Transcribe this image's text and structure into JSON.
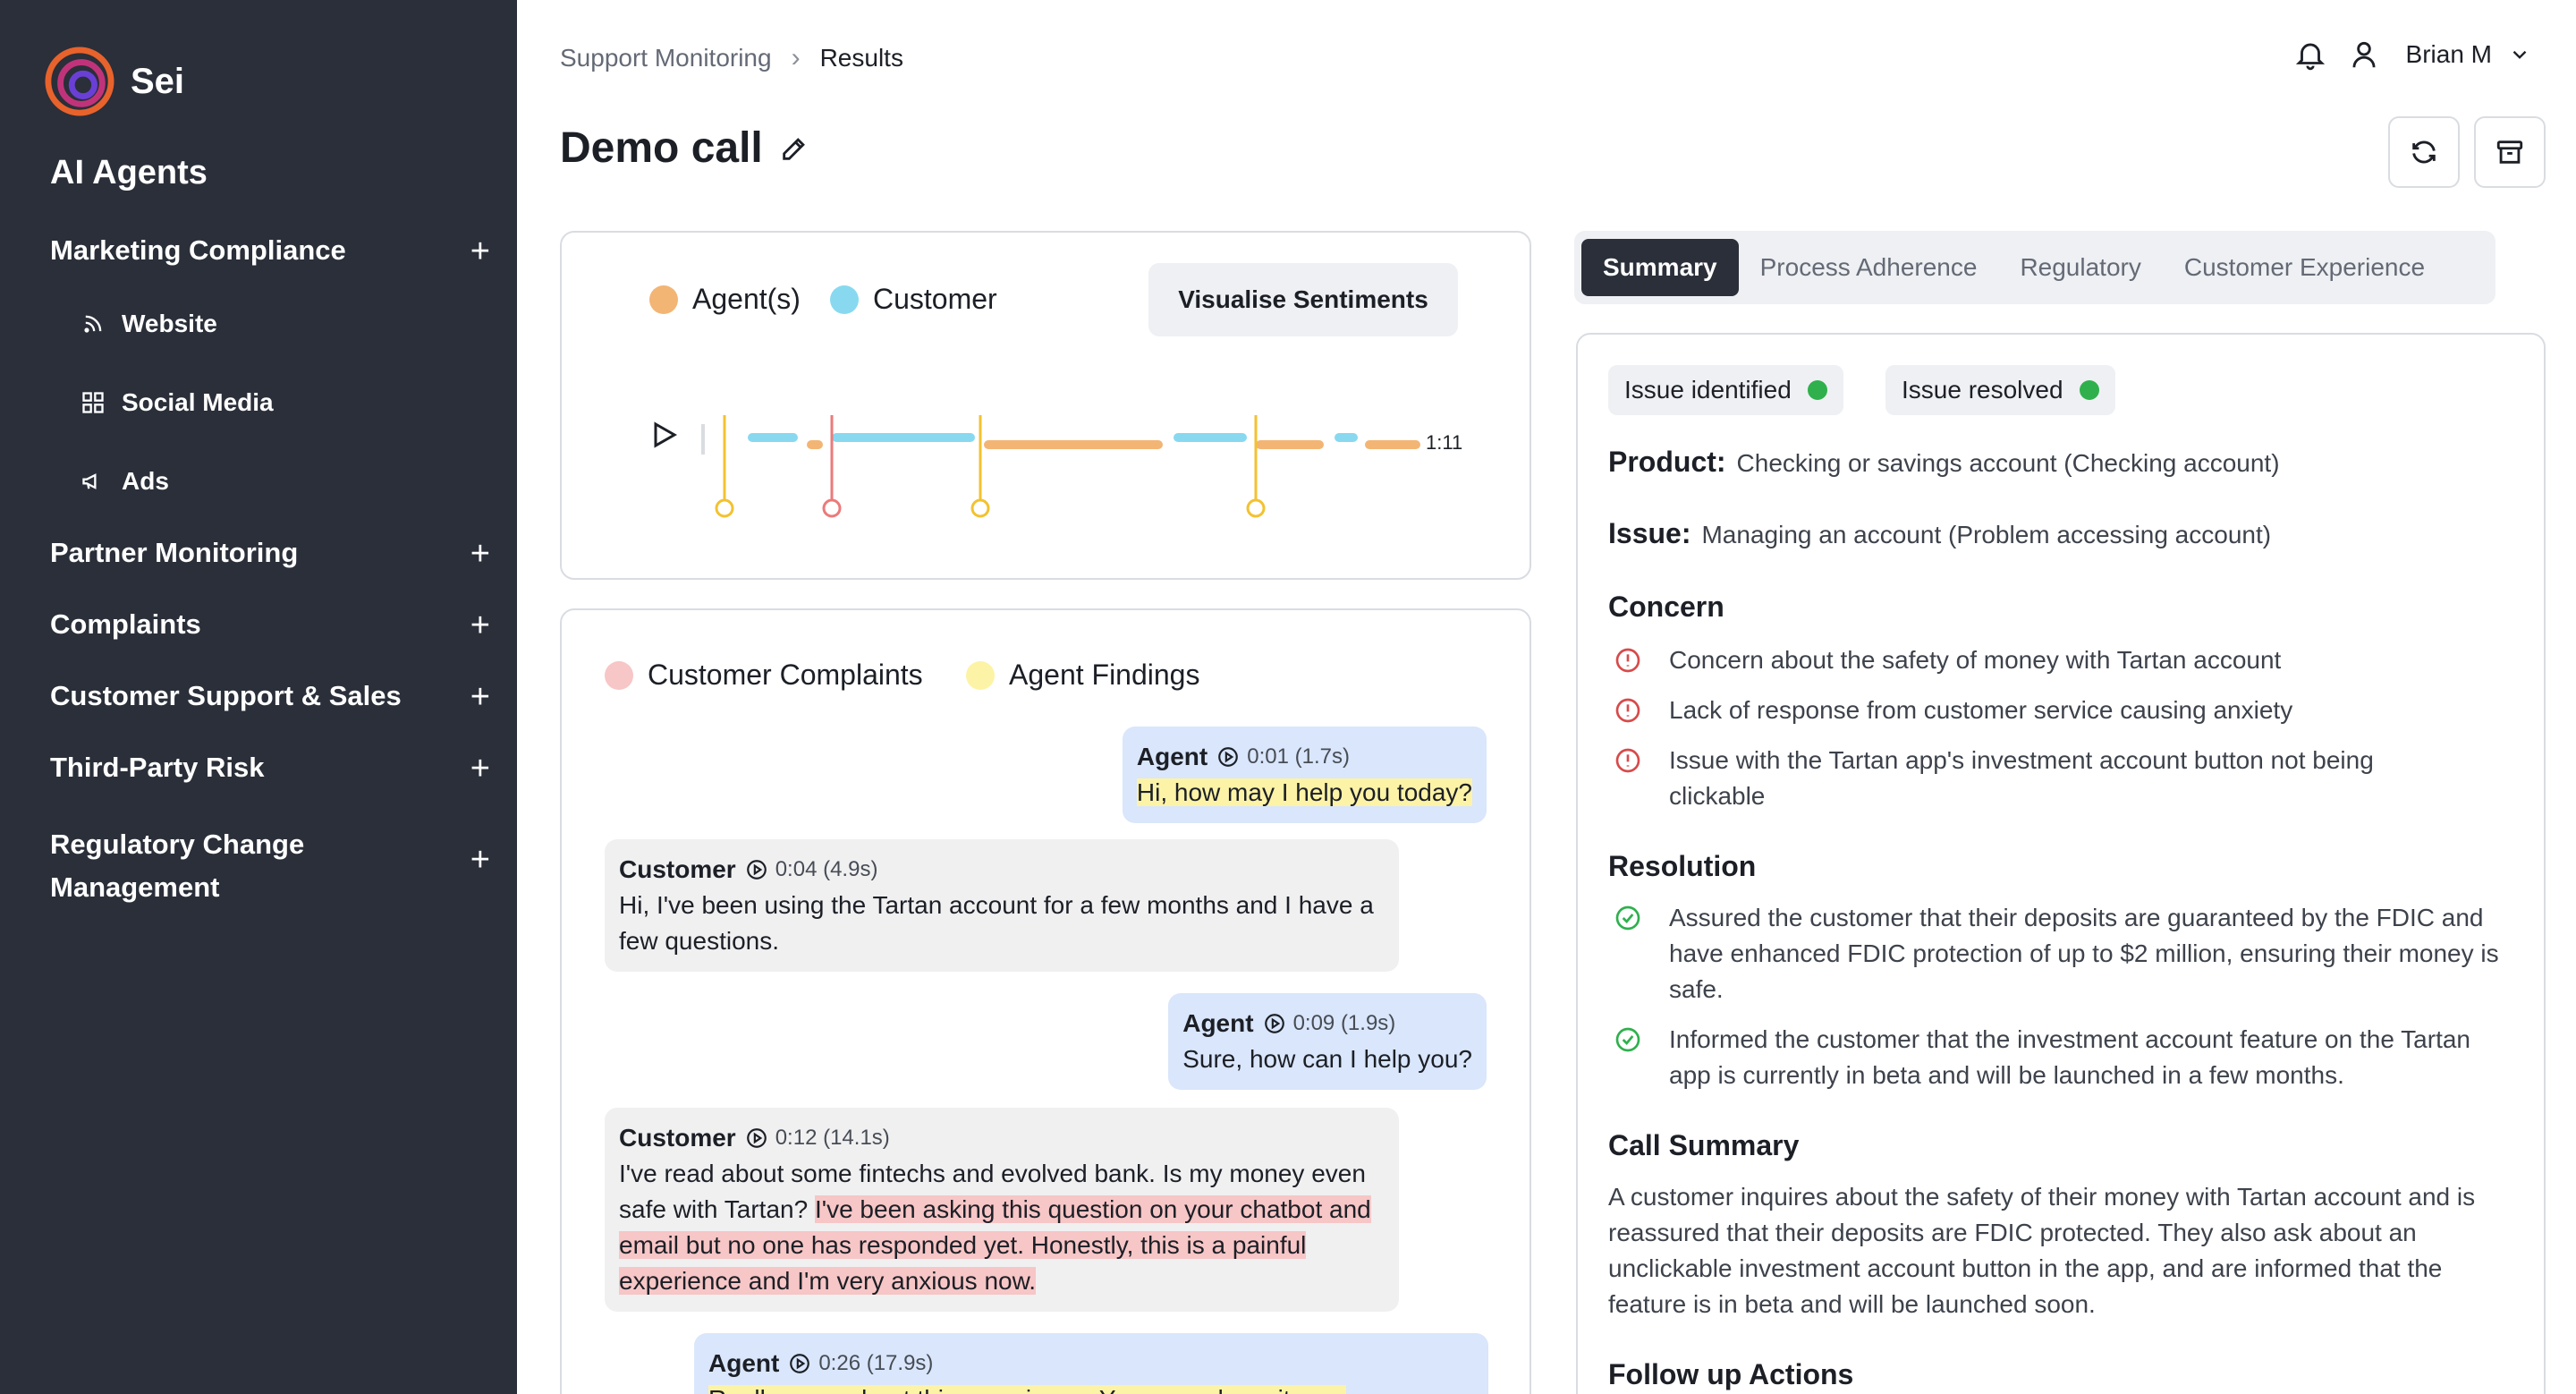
{
  "app": {
    "name": "Sei",
    "section": "AI Agents"
  },
  "sidebar": {
    "items": [
      {
        "label": "Marketing Compliance",
        "children": [
          "Website",
          "Social Media",
          "Ads"
        ]
      },
      {
        "label": "Partner Monitoring"
      },
      {
        "label": "Complaints"
      },
      {
        "label": "Customer Support & Sales"
      },
      {
        "label": "Third-Party Risk"
      },
      {
        "label": "Regulatory Change Management"
      }
    ]
  },
  "header": {
    "breadcrumb": [
      "Support Monitoring",
      "Results"
    ],
    "user_name": "Brian M",
    "title": "Demo call"
  },
  "audio": {
    "legend": [
      "Agent(s)",
      "Customer"
    ],
    "visualise_label": "Visualise Sentiments",
    "duration": "1:11",
    "colors": {
      "agent": "#f3b574",
      "customer": "#88d9f0",
      "marker_yellow": "#f3c230",
      "marker_red": "#ec7a7a"
    }
  },
  "transcript": {
    "legend": [
      "Customer Complaints",
      "Agent Findings"
    ],
    "legend_colors": {
      "complaints": "#f7c6c6",
      "findings": "#fdf3a6"
    },
    "messages": [
      {
        "speaker": "Agent",
        "time": "0:01 (1.7s)",
        "parts": [
          {
            "t": "Hi, how may I help you today?",
            "hl": "y"
          }
        ]
      },
      {
        "speaker": "Customer",
        "time": "0:04 (4.9s)",
        "parts": [
          {
            "t": "Hi, I've been using the Tartan account for a few months and I have a few questions.",
            "hl": ""
          }
        ]
      },
      {
        "speaker": "Agent",
        "time": "0:09 (1.9s)",
        "parts": [
          {
            "t": "Sure, how can I help you?",
            "hl": ""
          }
        ]
      },
      {
        "speaker": "Customer",
        "time": "0:12 (14.1s)",
        "parts": [
          {
            "t": "I've read about some fintechs and evolved bank. Is my money even safe with Tartan? ",
            "hl": ""
          },
          {
            "t": "I've been asking this question on your chatbot and email but no one has responded yet. Honestly, this is a painful experience and I'm very anxious now.",
            "hl": "r"
          }
        ]
      },
      {
        "speaker": "Agent",
        "time": "0:26 (17.9s)",
        "parts": [
          {
            "t": "Really sorry about this experience. Yes, your deposits are",
            "hl": "y"
          }
        ]
      }
    ]
  },
  "tabs": [
    "Summary",
    "Process Adherence",
    "Regulatory",
    "Customer Experience"
  ],
  "summary": {
    "badges": [
      "Issue identified",
      "Issue resolved"
    ],
    "product_label": "Product:",
    "product": "Checking or savings account (Checking account)",
    "issue_label": "Issue:",
    "issue": "Managing an account (Problem accessing account)",
    "concern_title": "Concern",
    "concerns": [
      "Concern about the safety of money with Tartan account",
      "Lack of response from customer service causing anxiety",
      "Issue with the Tartan app's investment account button not being clickable"
    ],
    "resolution_title": "Resolution",
    "resolutions": [
      "Assured the customer that their deposits are guaranteed by the FDIC and have enhanced FDIC protection of up to $2 million, ensuring their money is safe.",
      "Informed the customer that the investment account feature on the Tartan app is currently in beta and will be launched in a few months."
    ],
    "call_summary_title": "Call Summary",
    "call_summary": "A customer inquires about the safety of their money with Tartan account and is reassured that their deposits are FDIC protected. They also ask about an unclickable investment account button in the app, and are informed that the feature is in beta and will be launched soon.",
    "follow_up_title": "Follow up Actions"
  }
}
